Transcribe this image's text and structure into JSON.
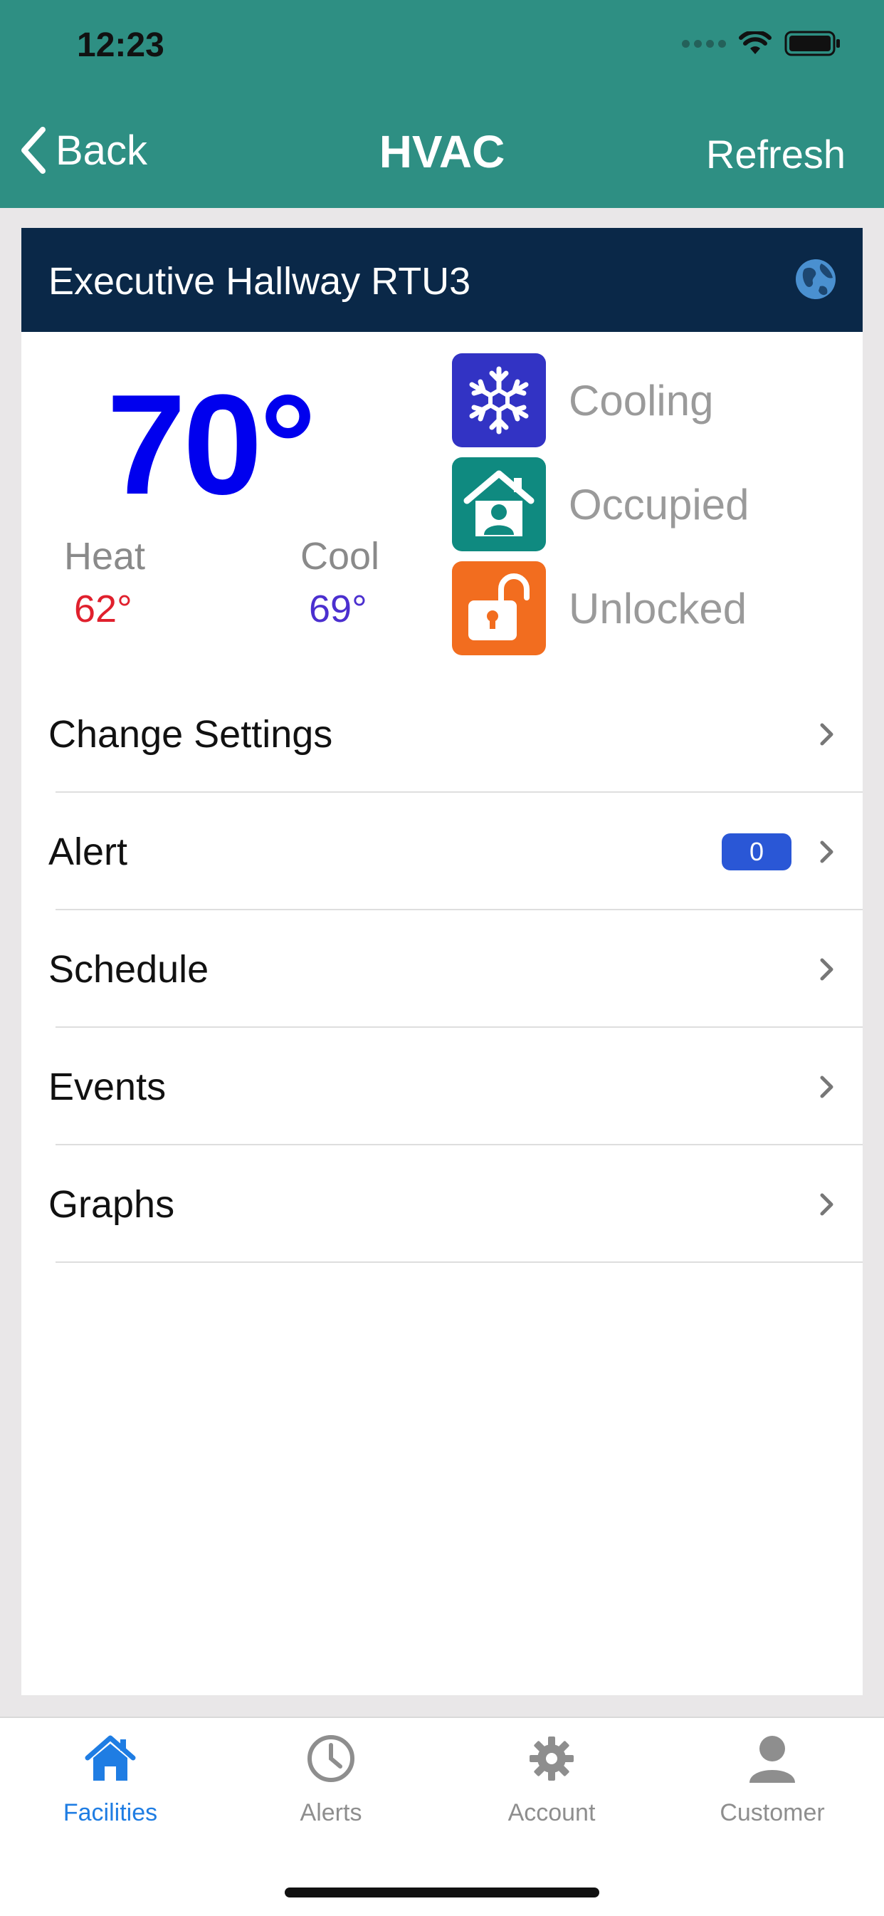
{
  "status_bar": {
    "time": "12:23"
  },
  "nav": {
    "back_label": "Back",
    "title": "HVAC",
    "refresh_label": "Refresh"
  },
  "device": {
    "name": "Executive Hallway RTU3",
    "current_temp": "70°",
    "heat": {
      "label": "Heat",
      "value": "62°"
    },
    "cool": {
      "label": "Cool",
      "value": "69°"
    },
    "statuses": [
      {
        "label": "Cooling",
        "icon": "snowflake-icon",
        "color": "#3233c4"
      },
      {
        "label": "Occupied",
        "icon": "home-person-icon",
        "color": "#0f8a80"
      },
      {
        "label": "Unlocked",
        "icon": "unlocked-padlock-icon",
        "color": "#f26d1f"
      }
    ]
  },
  "menu": {
    "items": [
      {
        "label": "Change Settings"
      },
      {
        "label": "Alert",
        "badge": "0"
      },
      {
        "label": "Schedule"
      },
      {
        "label": "Events"
      },
      {
        "label": "Graphs"
      }
    ]
  },
  "tabs": [
    {
      "label": "Facilities",
      "icon": "house-icon",
      "active": true
    },
    {
      "label": "Alerts",
      "icon": "clock-icon"
    },
    {
      "label": "Account",
      "icon": "gear-icon"
    },
    {
      "label": "Customer",
      "icon": "person-icon"
    }
  ],
  "colors": {
    "nav_bg": "#2e8f83",
    "header_bg": "#0a2848",
    "accent": "#1f7de3",
    "temp": "#0000ee",
    "heat": "#e0202d",
    "cool": "#4b2fcf",
    "badge": "#2a57d6"
  }
}
